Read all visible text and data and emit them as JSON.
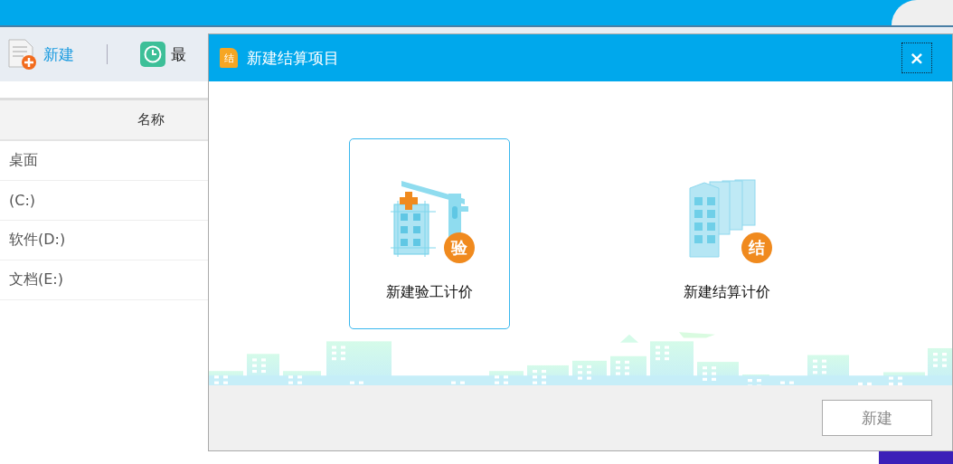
{
  "app": {
    "toolbar": [
      {
        "kind": "new",
        "label": "新建"
      },
      {
        "kind": "recent",
        "label": "最"
      }
    ],
    "list": {
      "header": "名称",
      "rows": [
        {
          "label": "桌面"
        },
        {
          "label": "(C:)"
        },
        {
          "label": "软件(D:)"
        },
        {
          "label": "文档(E:)"
        }
      ]
    }
  },
  "dialog": {
    "title_icon": "结",
    "title": "新建结算项目",
    "close": "×",
    "options": [
      {
        "kind": "crane",
        "label": "新建验工计价",
        "badge": "验",
        "selected": true
      },
      {
        "kind": "towers",
        "label": "新建结算计价",
        "badge": "结",
        "selected": false
      }
    ],
    "buttons": [
      {
        "label": "新建",
        "disabled": true
      }
    ]
  }
}
